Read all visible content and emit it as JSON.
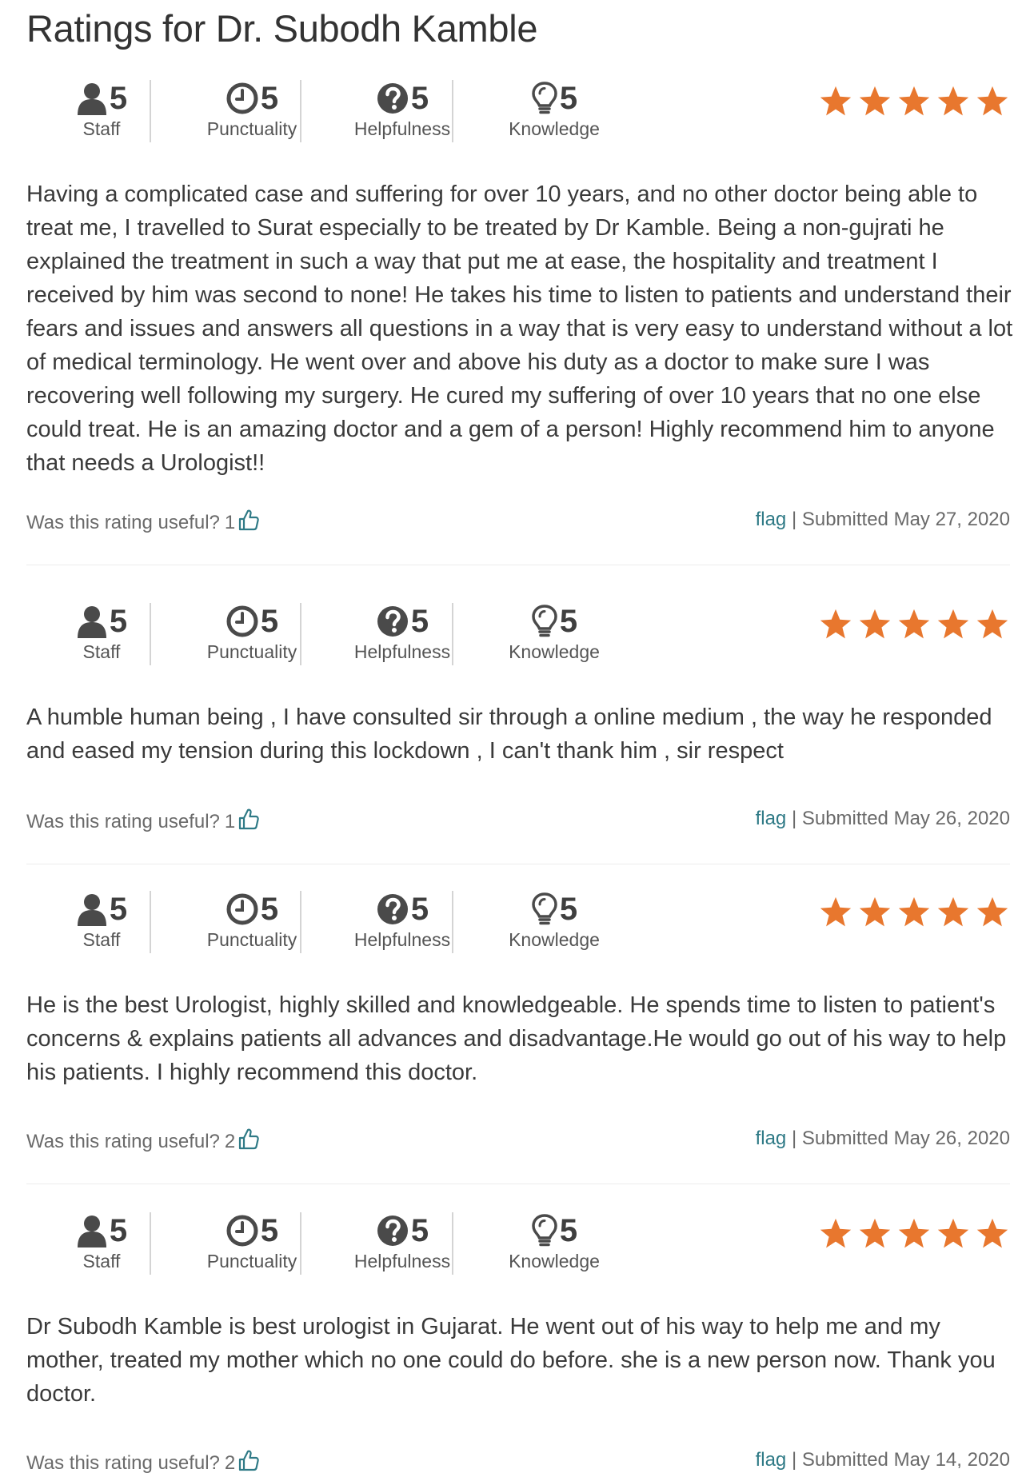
{
  "title": "Ratings for Dr. Subodh Kamble",
  "colors": {
    "star": "#e8772e",
    "link": "#2f7a86",
    "text": "#3a3a3a"
  },
  "metric_icons": [
    "user-icon",
    "clock-icon",
    "question-circle-icon",
    "lightbulb-icon"
  ],
  "reviews": [
    {
      "metrics": [
        {
          "label": "Staff",
          "score": "5"
        },
        {
          "label": "Punctuality",
          "score": "5"
        },
        {
          "label": "Helpfulness",
          "score": "5"
        },
        {
          "label": "Knowledge",
          "score": "5"
        }
      ],
      "stars": 5,
      "text": "Having a complicated case and suffering for over 10 years, and no other doctor being able to treat me, I travelled to Surat especially to be treated by Dr Kamble. Being a non-gujrati he explained the treatment in such a way that put me at ease, the hospitality and treatment I received by him was second to none! He takes his time to listen to patients and understand their fears and issues and answers all questions in a way that is very easy to understand without a lot of medical terminology. He went over and above his duty as a doctor to make sure I was recovering well following my surgery. He cured my suffering of over 10 years that no one else could treat. He is an amazing doctor and a gem of a person! Highly recommend him to anyone that needs a Urologist!!",
      "useful_label": "Was this rating useful?",
      "useful_count": "1",
      "flag": "flag",
      "separator": "|",
      "submitted": "Submitted May 27, 2020"
    },
    {
      "metrics": [
        {
          "label": "Staff",
          "score": "5"
        },
        {
          "label": "Punctuality",
          "score": "5"
        },
        {
          "label": "Helpfulness",
          "score": "5"
        },
        {
          "label": "Knowledge",
          "score": "5"
        }
      ],
      "stars": 5,
      "text": "A humble human being , I have consulted sir through a online medium , the way he responded and eased my tension during this lockdown , I can't thank him , sir respect",
      "useful_label": "Was this rating useful?",
      "useful_count": "1",
      "flag": "flag",
      "separator": "|",
      "submitted": "Submitted May 26, 2020"
    },
    {
      "metrics": [
        {
          "label": "Staff",
          "score": "5"
        },
        {
          "label": "Punctuality",
          "score": "5"
        },
        {
          "label": "Helpfulness",
          "score": "5"
        },
        {
          "label": "Knowledge",
          "score": "5"
        }
      ],
      "stars": 5,
      "text": "He is the best Urologist, highly skilled and knowledgeable. He spends time to listen to patient's concerns & explains patients all advances and disadvantage.He would go out of his way to help his patients. I highly recommend this doctor.",
      "useful_label": "Was this rating useful?",
      "useful_count": "2",
      "flag": "flag",
      "separator": "|",
      "submitted": "Submitted May 26, 2020"
    },
    {
      "metrics": [
        {
          "label": "Staff",
          "score": "5"
        },
        {
          "label": "Punctuality",
          "score": "5"
        },
        {
          "label": "Helpfulness",
          "score": "5"
        },
        {
          "label": "Knowledge",
          "score": "5"
        }
      ],
      "stars": 5,
      "text": "Dr Subodh Kamble is best urologist in Gujarat. He went out of his way to help me and my mother, treated my mother which no one could do before. she is a new person now. Thank you doctor.",
      "useful_label": "Was this rating useful?",
      "useful_count": "2",
      "flag": "flag",
      "separator": "|",
      "submitted": "Submitted May 14, 2020"
    }
  ]
}
